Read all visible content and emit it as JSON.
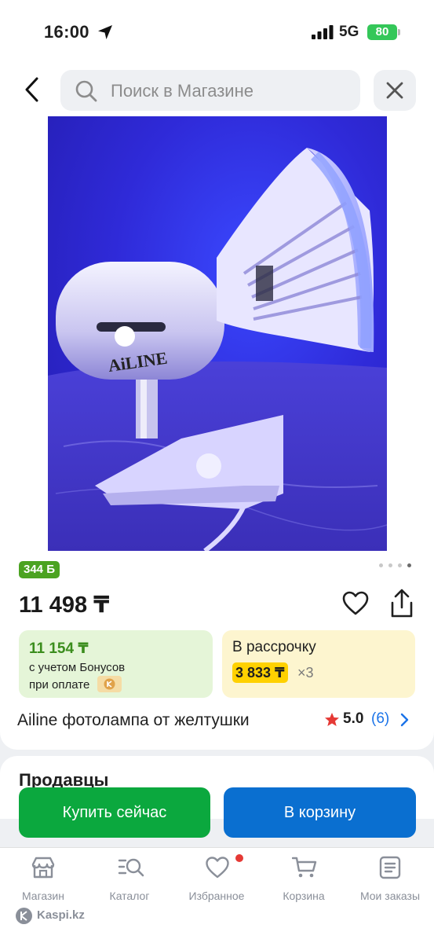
{
  "status_bar": {
    "time": "16:00",
    "network": "5G",
    "battery": "80"
  },
  "header": {
    "search_placeholder": "Поиск в Магазине"
  },
  "product": {
    "bonus_points": "344 Б",
    "price": "11 498 ₸",
    "bonus_offer": {
      "price": "11 154 ₸",
      "line1": "с учетом Бонусов",
      "line2": "при оплате"
    },
    "installment": {
      "label": "В рассрочку",
      "price": "3 833 ₸",
      "multiplier": "×3"
    },
    "title": "Ailine фотолампа от желтушки",
    "rating": "5.0",
    "reviews": "(6)",
    "image_brand_text": "AiLINE"
  },
  "gallery": {
    "dot_count": 4,
    "active_index": 3
  },
  "sellers": {
    "title": "Продавцы"
  },
  "actions": {
    "buy_now": "Купить сейчас",
    "add_to_cart": "В корзину"
  },
  "tabbar": {
    "tabs": [
      {
        "label": "Магазин",
        "icon": "shop-icon"
      },
      {
        "label": "Каталог",
        "icon": "catalog-search-icon"
      },
      {
        "label": "Избранное",
        "icon": "heart-icon"
      },
      {
        "label": "Корзина",
        "icon": "cart-icon"
      },
      {
        "label": "Мои заказы",
        "icon": "orders-icon"
      }
    ],
    "brand": "Kaspi.kz"
  },
  "colors": {
    "green": "#0ba83e",
    "blue": "#0a6fd0",
    "bonus_green": "#4ba321",
    "installment_yellow": "#ffd100"
  }
}
